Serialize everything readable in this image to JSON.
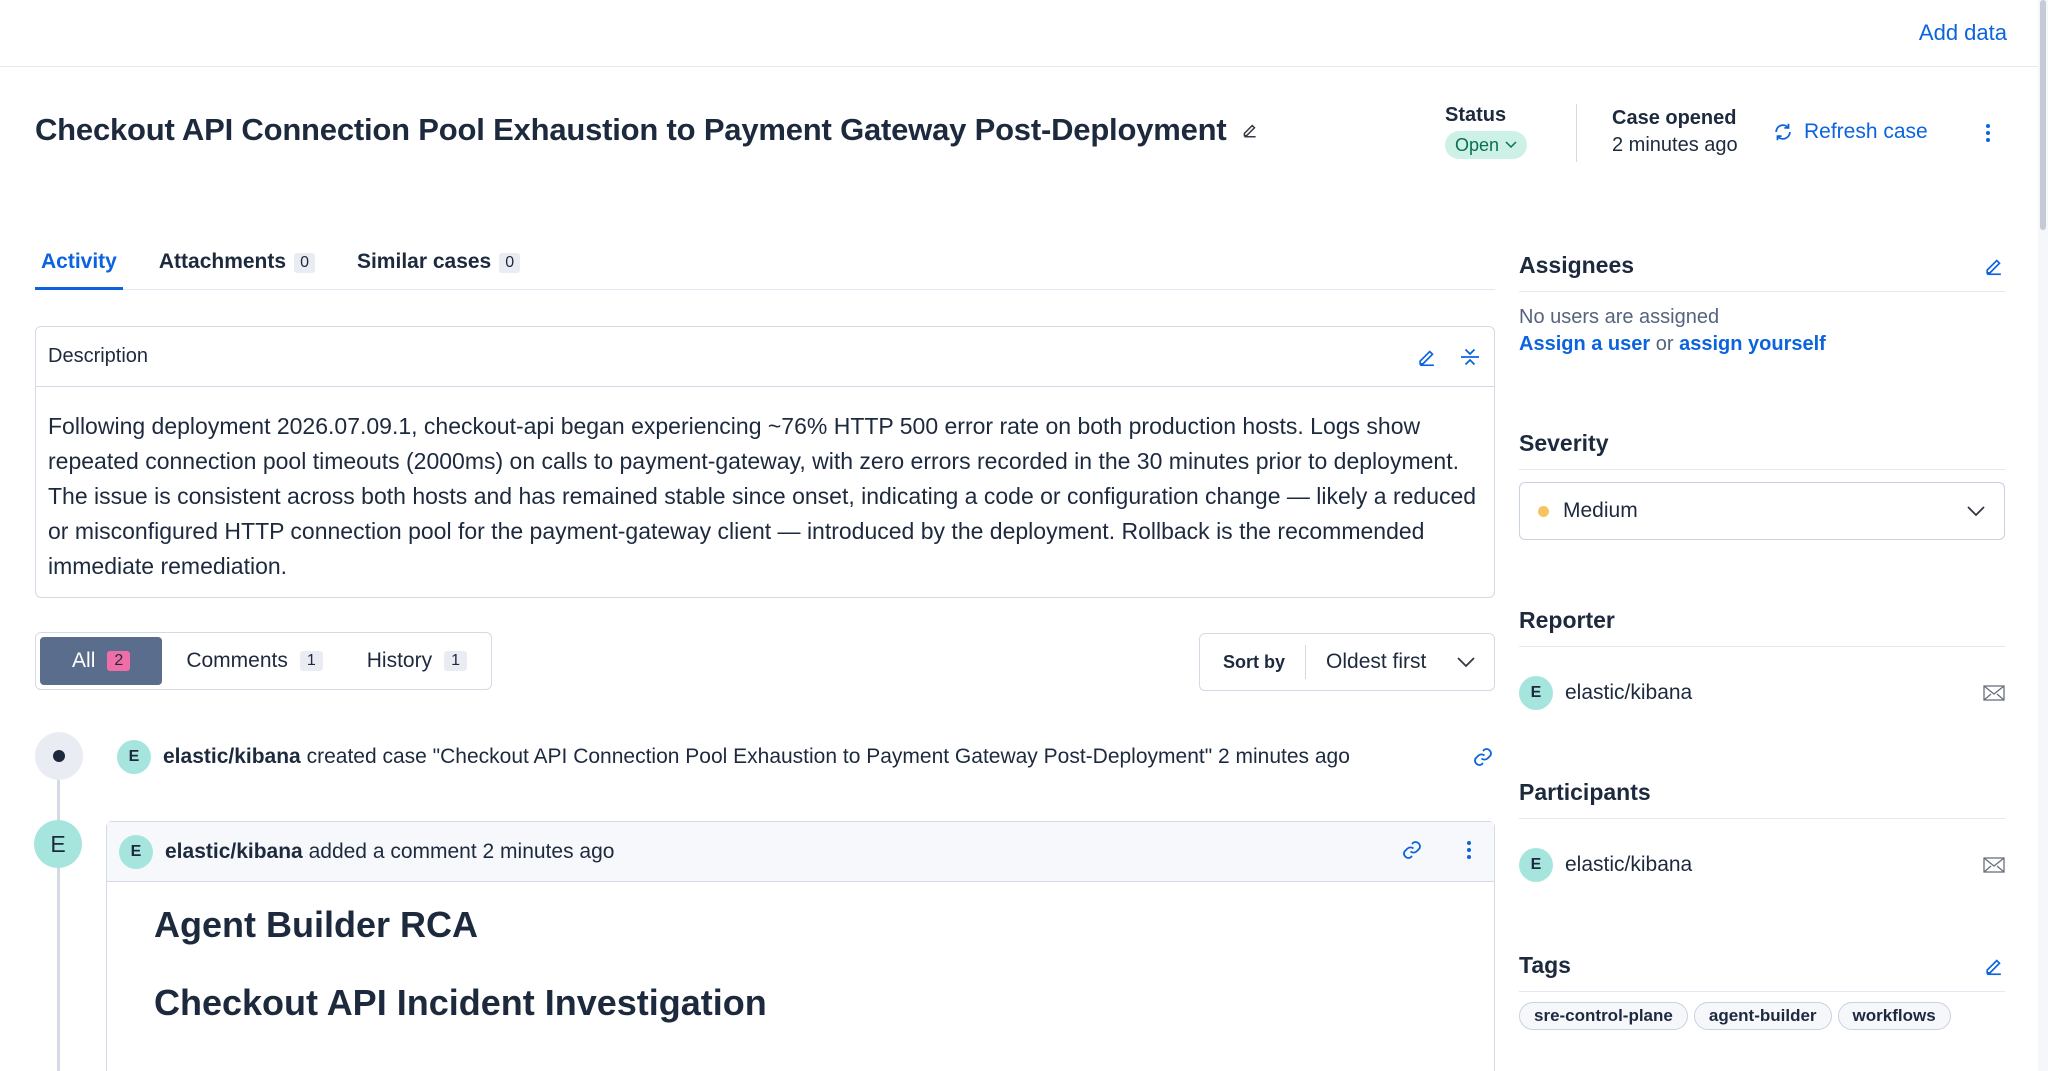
{
  "header": {
    "add_data": "Add data"
  },
  "case": {
    "title": "Checkout API Connection Pool Exhaustion to Payment Gateway Post-Deployment",
    "status_label": "Status",
    "status_value": "Open",
    "opened_label": "Case opened",
    "opened_value": "2 minutes ago",
    "refresh_label": "Refresh case"
  },
  "tabs": [
    {
      "label": "Activity",
      "count": null
    },
    {
      "label": "Attachments",
      "count": "0"
    },
    {
      "label": "Similar cases",
      "count": "0"
    }
  ],
  "description": {
    "title": "Description",
    "body": "Following deployment 2026.07.09.1, checkout-api began experiencing ~76% HTTP 500 error rate on both production hosts. Logs show repeated connection pool timeouts (2000ms) on calls to payment-gateway, with zero errors recorded in the 30 minutes prior to deployment. The issue is consistent across both hosts and has remained stable since onset, indicating a code or configuration change — likely a reduced or misconfigured HTTP connection pool for the payment-gateway client — introduced by the deployment. Rollback is the recommended immediate remediation."
  },
  "filters": {
    "all_label": "All",
    "all_count": "2",
    "comments_label": "Comments",
    "comments_count": "1",
    "history_label": "History",
    "history_count": "1"
  },
  "sort": {
    "label": "Sort by",
    "value": "Oldest first"
  },
  "timeline": {
    "event": {
      "avatar": "E",
      "user": "elastic/kibana",
      "action": "created case \"Checkout API Connection Pool Exhaustion to Payment Gateway Post-Deployment\" 2 minutes ago"
    },
    "comment": {
      "big_avatar": "E",
      "avatar": "E",
      "user": "elastic/kibana",
      "action": "added a comment 2 minutes ago",
      "h1": "Agent Builder RCA",
      "h2": "Checkout API Incident Investigation"
    }
  },
  "sidebar": {
    "assignees": {
      "title": "Assignees",
      "empty": "No users are assigned",
      "assign_user": "Assign a user",
      "or": "or",
      "assign_yourself": "assign yourself"
    },
    "severity": {
      "title": "Severity",
      "value": "Medium",
      "color": "#f5c45e"
    },
    "reporter": {
      "title": "Reporter",
      "avatar": "E",
      "name": "elastic/kibana"
    },
    "participants": {
      "title": "Participants",
      "avatar": "E",
      "name": "elastic/kibana"
    },
    "tags": {
      "title": "Tags",
      "items": [
        "sre-control-plane",
        "agent-builder",
        "workflows"
      ]
    }
  },
  "colors": {
    "accent": "#0b64dd",
    "status_bg": "#cdf1e6",
    "status_text": "#0a6e52",
    "avatar_bg": "#a6e5de",
    "active_filter": "#5a6d8c",
    "badge_pink": "#f06ea8"
  }
}
